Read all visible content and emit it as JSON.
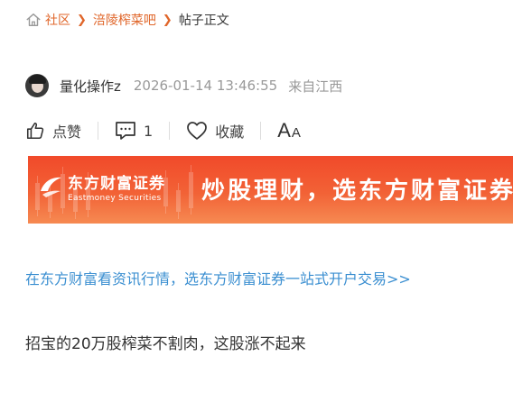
{
  "breadcrumb": {
    "items": [
      "社区",
      "涪陵榨菜吧"
    ],
    "current": "帖子正文",
    "separator": "❯"
  },
  "post": {
    "author": "量化操作z",
    "timestamp": "2026-01-14 13:46:55",
    "source": "来自江西",
    "content": "招宝的20万股榨菜不割肉，这股涨不起来"
  },
  "actions": {
    "like_label": "点赞",
    "comment_count": "1",
    "favorite_label": "收藏",
    "font_big": "A",
    "font_small": "A"
  },
  "banner": {
    "brand_cn": "东方财富证券",
    "brand_en": "Eastmoney Securities",
    "slogan": "炒股理财，选东方财富证券"
  },
  "promo_link": "在东方财富看资讯行情，选东方财富证券一站式开户交易>>",
  "colors": {
    "accent": "#e0662a",
    "link": "#3b8fd1",
    "banner_top": "#f14a2a",
    "banner_bottom": "#f68a52"
  },
  "icons": [
    "home-icon",
    "thumbs-up-icon",
    "comment-icon",
    "heart-icon",
    "font-size-icon",
    "eastmoney-logo-icon"
  ]
}
